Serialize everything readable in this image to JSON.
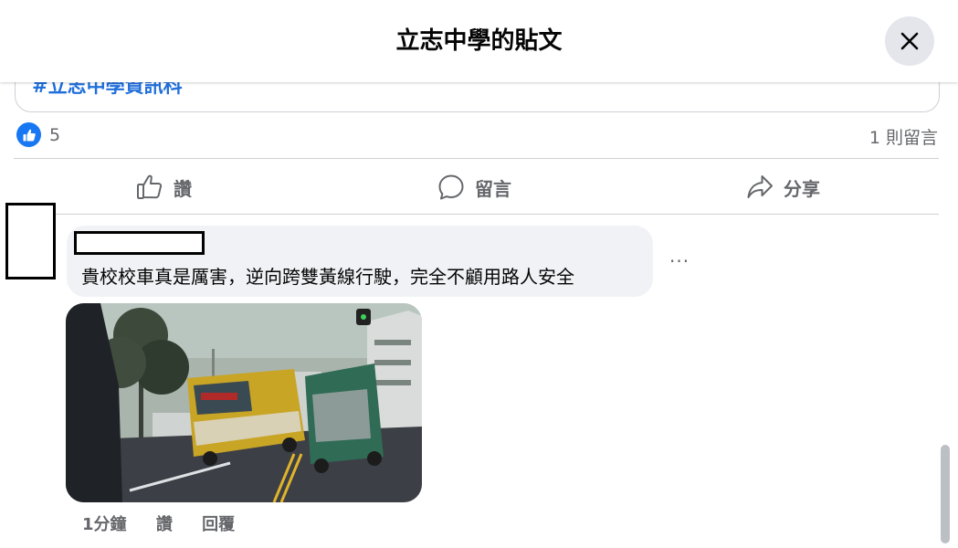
{
  "dialog": {
    "title": "立志中學的貼文"
  },
  "post": {
    "hashtag": "#立志中學資訊科"
  },
  "reactions": {
    "count": "5",
    "comments_label": "1 則留言"
  },
  "actions": {
    "like": "讚",
    "comment": "留言",
    "share": "分享"
  },
  "comment": {
    "text": "貴校校車真是厲害，逆向跨雙黃線行駛，完全不顧用路人安全",
    "more": "···",
    "time": "1分鐘",
    "like": "讚",
    "reply": "回覆"
  },
  "colors": {
    "accent": "#1877f2",
    "muted_text": "#65676b",
    "bubble_bg": "#f0f2f5",
    "divider": "#ced0d4"
  },
  "icons": {
    "close": "close-icon",
    "like_badge": "thumbs-up-icon",
    "like": "thumbs-up-outline-icon",
    "comment": "comment-bubble-icon",
    "share": "share-arrow-icon"
  }
}
